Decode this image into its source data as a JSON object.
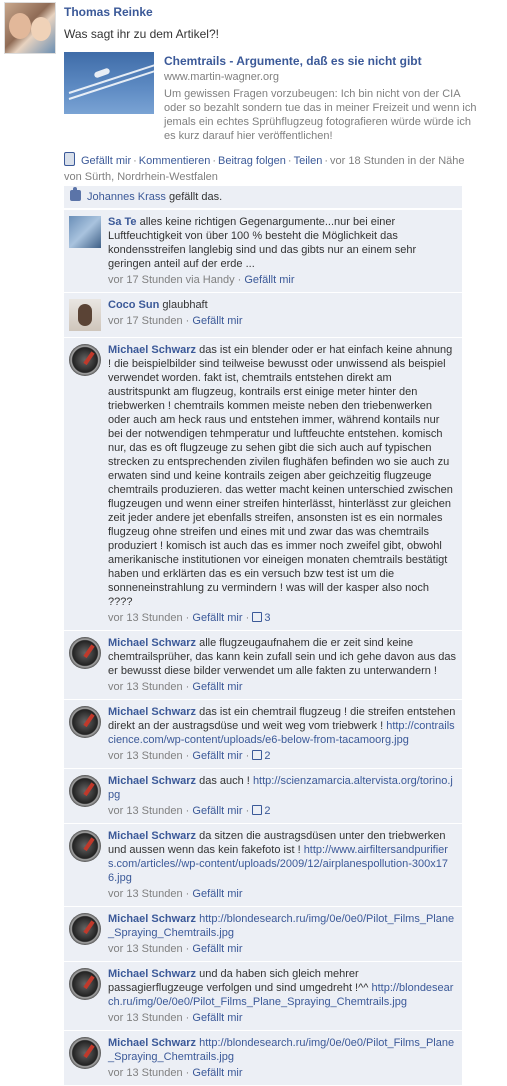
{
  "post": {
    "author": "Thomas Reinke",
    "message": "Was sagt ihr zu dem Artikel?!",
    "attachment": {
      "title": "Chemtrails - Argumente, daß es sie nicht gibt",
      "url": "www.martin-wagner.org",
      "description": "Um gewissen Fragen vorzubeugen: Ich bin nicht von der CIA oder so bezahlt sondern tue das in meiner Freizeit und wenn ich jemals ein echtes Sprühflugzeug fotografieren würde würde ich es kurz darauf hier veröffentlichen!"
    },
    "actions": {
      "like": "Gefällt mir",
      "comment": "Kommentieren",
      "follow": "Beitrag folgen",
      "share": "Teilen",
      "time_location": "vor 18 Stunden in der Nähe von Sürth, Nordrhein-Westfalen"
    },
    "likes": {
      "name": "Johannes Krass",
      "suffix": "gefällt das."
    }
  },
  "comments": [
    {
      "name": "Sa Te",
      "text": "alles keine richtigen Gegenargumente...nur bei einer Luftfeuchtigkeit von über 100 % besteht die Möglichkeit das kondensstreifen langlebig sind und das gibts nur an einem sehr geringen anteil auf der erde ...",
      "time": "vor 17 Stunden via Handy",
      "like": "Gefällt mir",
      "count": ""
    },
    {
      "name": "Coco Sun",
      "text": "glaubhaft",
      "time": "vor 17 Stunden",
      "like": "Gefällt mir",
      "count": ""
    },
    {
      "name": "Michael Schwarz",
      "text": "das ist ein blender oder er hat einfach keine ahnung ! die beispielbilder sind teilweise bewusst oder unwissend als beispiel verwendet worden. fakt ist, chemtrails entstehen direkt am austritspunkt am flugzeug, kontrails erst einige meter hinter den triebwerken ! chemtrails kommen meiste neben den triebenwerken oder auch am heck raus und entstehen immer, während kontails nur bei der notwendigen tehmperatur und luftfeuchte entstehen. komisch nur, das es oft flugzeuge zu sehen gibt die sich auch auf typischen strecken zu entsprechenden zivilen flughäfen befinden wo sie auch zu erwaten sind und keine kontrails zeigen aber geichzeitig flugzeuge chemtrails produzieren. das wetter macht keinen unterschied zwischen flugzeugen und wenn einer streifen hinterlässt, hinterlässt zur gleichen zeit jeder andere jet ebenfalls streifen, ansonsten ist es ein normales flugzeug ohne streifen und eines mit und zwar das was chemtrails produziert ! komisch ist auch das es immer noch zweifel gibt, obwohl amerikanische institutionen vor eineigen monaten chemtrails bestätigt haben und erklärten das es ein versuch bzw test ist um die sonneneinstrahlung zu vermindern ! was will der kasper also noch ????",
      "time": "vor 13 Stunden",
      "like": "Gefällt mir",
      "count": "3"
    },
    {
      "name": "Michael Schwarz",
      "text": "alle flugzeugaufnahem die er zeit sind keine chemtrailsprüher, das kann kein zufall sein und ich gehe davon aus das er bewusst diese bilder verwendet um alle fakten zu unterwandern !",
      "time": "vor 13 Stunden",
      "like": "Gefällt mir",
      "count": ""
    },
    {
      "name": "Michael Schwarz",
      "text": "das ist ein chemtrail flugzeug ! die streifen entstehen direkt an der austragsdüse und weit weg vom triebwerk !",
      "link": "http://contrailscience.com/wp-content/uploads/e6-below-from-tacamoorg.jpg",
      "time": "vor 13 Stunden",
      "like": "Gefällt mir",
      "count": "2"
    },
    {
      "name": "Michael Schwarz",
      "text": "das auch !",
      "link": "http://scienzamarcia.altervista.org/torino.jpg",
      "time": "vor 13 Stunden",
      "like": "Gefällt mir",
      "count": "2"
    },
    {
      "name": "Michael Schwarz",
      "text": "da sitzen die austragsdüsen unter den triebwerken und aussen wenn das kein fakefoto ist !",
      "link": "http://www.airfiltersandpurifiers.com/articles//wp-content/uploads/2009/12/airplanespollution-300x176.jpg",
      "time": "vor 13 Stunden",
      "like": "Gefällt mir",
      "count": ""
    },
    {
      "name": "Michael Schwarz",
      "text": "",
      "link": "http://blondesearch.ru/img/0e/0e0/Pilot_Films_Plane_Spraying_Chemtrails.jpg",
      "time": "vor 13 Stunden",
      "like": "Gefällt mir",
      "count": ""
    },
    {
      "name": "Michael Schwarz",
      "text": "und da haben sich gleich mehrer passagierflugzeuge verfolgen und sind umgedreht !^^",
      "link": "http://blondesearch.ru/img/0e/0e0/Pilot_Films_Plane_Spraying_Chemtrails.jpg",
      "time": "vor 13 Stunden",
      "like": "Gefällt mir",
      "count": ""
    },
    {
      "name": "Michael Schwarz",
      "text": "",
      "link": "http://blondesearch.ru/img/0e/0e0/Pilot_Films_Plane_Spraying_Chemtrails.jpg",
      "time": "vor 13 Stunden",
      "like": "Gefällt mir",
      "count": ""
    }
  ]
}
